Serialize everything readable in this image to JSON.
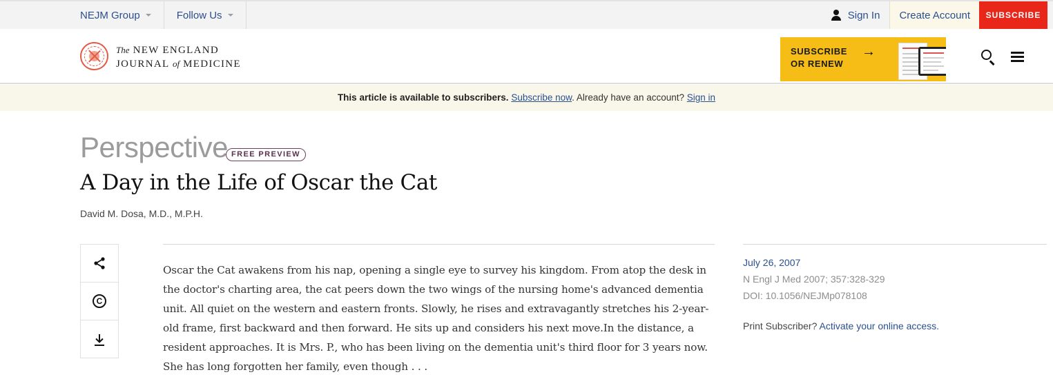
{
  "utility_bar": {
    "nejm_group": "NEJM Group",
    "follow_us": "Follow Us",
    "sign_in": "Sign In",
    "create_account": "Create Account",
    "subscribe": "SUBSCRIBE"
  },
  "masthead": {
    "logo_line1_prefix": "The",
    "logo_line1": "NEW ENGLAND",
    "logo_line2_a": "JOURNAL",
    "logo_line2_of": "of",
    "logo_line2_b": "MEDICINE",
    "promo_line1": "SUBSCRIBE",
    "promo_line2": "OR RENEW",
    "promo_arrow": "→"
  },
  "notice": {
    "lead": "This article is available to subscribers.",
    "subscribe_link": "Subscribe now",
    "mid": ". Already have an account?",
    "signin_link": "Sign in"
  },
  "article": {
    "section": "Perspective",
    "badge": "FREE PREVIEW",
    "title": "A Day in the Life of Oscar the Cat",
    "author": "David M. Dosa, M.D., M.P.H.",
    "body": "Oscar the Cat awakens from his nap, opening a single eye to survey his kingdom. From atop the desk in the doctor's charting area, the cat peers down the two wings of the nursing home's advanced dementia unit. All quiet on the western and eastern fronts. Slowly, he rises and extravagantly stretches his 2-year-old frame, first backward and then forward. He sits up and considers his next move.In the distance, a resident approaches. It is Mrs. P., who has been living on the dementia unit's third floor for 3 years now. She has long forgotten her family, even though . . ."
  },
  "meta": {
    "date": "July 26, 2007",
    "citation": "N Engl J Med 2007; 357:328-329",
    "doi": "DOI: 10.1056/NEJMp078108",
    "print_prefix": "Print Subscriber?",
    "print_link": "Activate your online access."
  },
  "tools": {
    "copyright_glyph": "C"
  },
  "colors": {
    "link_blue": "#2a4f8f",
    "subscribe_red": "#e8261a",
    "promo_yellow": "#f6bd16",
    "notice_bg": "#f9f7ea"
  }
}
